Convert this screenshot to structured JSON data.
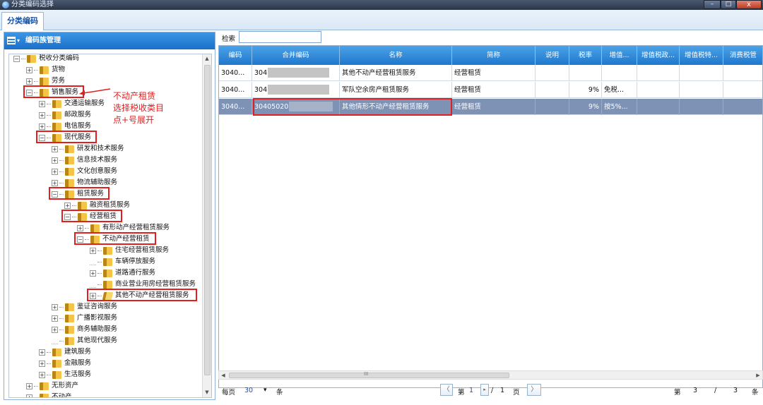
{
  "window": {
    "title": "分类编码选择",
    "close_glyph": "x",
    "min_glyph": "–",
    "max_glyph": "□"
  },
  "tab": {
    "label": "分类编码"
  },
  "left_panel": {
    "title": "编码族管理",
    "tree": [
      {
        "label": "税收分类编码",
        "depth": 0,
        "exp": "-",
        "boxed": false
      },
      {
        "label": "货物",
        "depth": 1,
        "exp": "+",
        "boxed": false
      },
      {
        "label": "劳务",
        "depth": 1,
        "exp": "+",
        "boxed": false
      },
      {
        "label": "销售服务",
        "depth": 1,
        "exp": "-",
        "boxed": true
      },
      {
        "label": "交通运输服务",
        "depth": 2,
        "exp": "+",
        "boxed": false
      },
      {
        "label": "邮政服务",
        "depth": 2,
        "exp": "+",
        "boxed": false
      },
      {
        "label": "电信服务",
        "depth": 2,
        "exp": "+",
        "boxed": false
      },
      {
        "label": "现代服务",
        "depth": 2,
        "exp": "-",
        "boxed": true
      },
      {
        "label": "研发和技术服务",
        "depth": 3,
        "exp": "+",
        "boxed": false
      },
      {
        "label": "信息技术服务",
        "depth": 3,
        "exp": "+",
        "boxed": false
      },
      {
        "label": "文化创意服务",
        "depth": 3,
        "exp": "+",
        "boxed": false
      },
      {
        "label": "物流辅助服务",
        "depth": 3,
        "exp": "+",
        "boxed": false
      },
      {
        "label": "租赁服务",
        "depth": 3,
        "exp": "-",
        "boxed": true
      },
      {
        "label": "融资租赁服务",
        "depth": 4,
        "exp": "+",
        "boxed": false
      },
      {
        "label": "经营租赁",
        "depth": 4,
        "exp": "-",
        "boxed": true
      },
      {
        "label": "有形动产经营租赁服务",
        "depth": 5,
        "exp": "+",
        "boxed": false
      },
      {
        "label": "不动产经营租赁",
        "depth": 5,
        "exp": "-",
        "boxed": true
      },
      {
        "label": "住宅经营租赁服务",
        "depth": 6,
        "exp": "+",
        "boxed": false
      },
      {
        "label": "车辆停放服务",
        "depth": 6,
        "exp": "",
        "boxed": false
      },
      {
        "label": "道路通行服务",
        "depth": 6,
        "exp": "+",
        "boxed": false
      },
      {
        "label": "商业营业用房经营租赁服务",
        "depth": 6,
        "exp": "",
        "boxed": false
      },
      {
        "label": "其他不动产经营租赁服务",
        "depth": 6,
        "exp": "+",
        "boxed": true,
        "open": true
      },
      {
        "label": "鉴证咨询服务",
        "depth": 3,
        "exp": "+",
        "boxed": false
      },
      {
        "label": "广播影视服务",
        "depth": 3,
        "exp": "+",
        "boxed": false
      },
      {
        "label": "商务辅助服务",
        "depth": 3,
        "exp": "+",
        "boxed": false
      },
      {
        "label": "其他现代服务",
        "depth": 3,
        "exp": "",
        "boxed": false
      },
      {
        "label": "建筑服务",
        "depth": 2,
        "exp": "+",
        "boxed": false
      },
      {
        "label": "金融服务",
        "depth": 2,
        "exp": "+",
        "boxed": false
      },
      {
        "label": "生活服务",
        "depth": 2,
        "exp": "+",
        "boxed": false
      },
      {
        "label": "无形资产",
        "depth": 1,
        "exp": "+",
        "boxed": false
      },
      {
        "label": "不动产",
        "depth": 1,
        "exp": "+",
        "boxed": false
      }
    ],
    "annotation": [
      "不动产租赁",
      "选择税收类目",
      "点+号展开"
    ],
    "annotation_color": "#e02020"
  },
  "search": {
    "label": "检索",
    "value": ""
  },
  "grid": {
    "columns": [
      "编码",
      "合并编码",
      "名称",
      "简称",
      "说明",
      "税率",
      "增值...",
      "增值税政...",
      "增值税特...",
      "消费税管"
    ],
    "rows": [
      {
        "code": "3040...",
        "merged": "304",
        "name": "其他不动产经营租赁服务",
        "short": "经营租赁",
        "note": "",
        "rate": "",
        "vat": "",
        "selected": false
      },
      {
        "code": "3040...",
        "merged": "304",
        "name": "军队空余房产租赁服务",
        "short": "经营租赁",
        "note": "",
        "rate": "9%",
        "vat": "免税...",
        "selected": false
      },
      {
        "code": "3040...",
        "merged": "30405020",
        "name": "其他情形不动产经营租赁服务",
        "short": "经营租赁",
        "note": "",
        "rate": "9%",
        "vat": "按5%...",
        "selected": true
      }
    ]
  },
  "pager": {
    "per_page_label": "每页",
    "per_page": "30",
    "unit": "条",
    "page_prefix": "第",
    "page": "1",
    "sep": "/",
    "total_pages": "1",
    "page_suffix": "页",
    "summary_prefix": "第",
    "summary_current": "3",
    "summary_sep": "/",
    "summary_total": "3",
    "summary_unit": "条",
    "prev": "〈",
    "next": "〉",
    "dropdown": "▾"
  },
  "hscroll_mark": "III",
  "colors": {
    "accent": "#1a6fca",
    "header": "#2077cc",
    "selected_row": "#7e92b5",
    "highlight": "#e02020"
  }
}
